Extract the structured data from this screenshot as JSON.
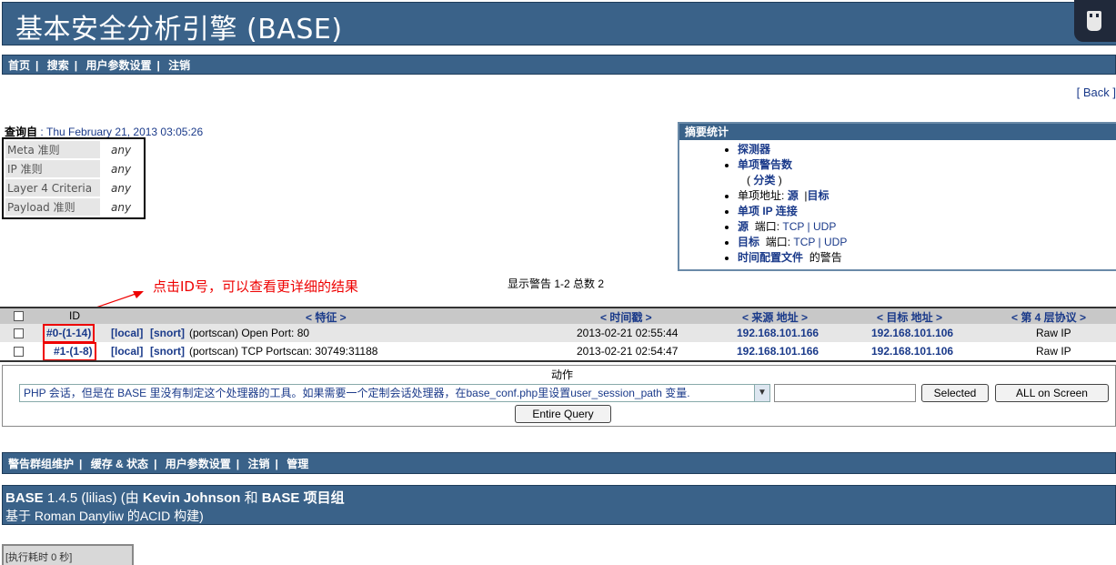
{
  "header": {
    "title": "基本安全分析引擎 (BASE)",
    "corner_icon": "usb-icon"
  },
  "topnav": {
    "items": [
      "首页",
      "搜索",
      "用户参数设置",
      "注销"
    ],
    "sep": "|"
  },
  "back_link": "[ Back ]",
  "query": {
    "label": "查询自",
    "datetime": ": Thu February 21, 2013 03:05:26",
    "criteria": [
      {
        "key": "Meta 准则",
        "value": "any"
      },
      {
        "key": "IP 准则",
        "value": "any"
      },
      {
        "key": "Layer 4 Criteria",
        "value": "any"
      },
      {
        "key": "Payload 准则",
        "value": "any"
      }
    ]
  },
  "summary": {
    "title": "摘要统计",
    "items": {
      "sensors": "探测器",
      "unique_alerts": "单项警告数",
      "categories_prefix": "(",
      "categories": "分类",
      "categories_suffix": ")",
      "unique_addr": "单项地址:",
      "src": "源",
      "sep": "|",
      "dst": "目标",
      "unique_ip_links": "单项  IP 连接",
      "src_port_label": "源",
      "port": "端口:",
      "tcp": "TCP",
      "udp": "UDP",
      "dst_port_label": "目标",
      "time_profile": "时间配置文件",
      "time_profile_suffix": "的警告"
    }
  },
  "annotation": "点击ID号，可以查看更详细的结果",
  "showing": "显示警告  1-2 总数  2",
  "table": {
    "headers": {
      "id": "ID",
      "signature": "< 特征 >",
      "timestamp": "< 时间戳 >",
      "src": "< 来源 地址 >",
      "dst": "< 目标 地址 >",
      "proto": "< 第 4 层协议 >"
    },
    "rows": [
      {
        "id": "#0-(1-14)",
        "sig_local": "[local]",
        "sig_snort": "[snort]",
        "sig_text": "(portscan) Open Port: 80",
        "time": "2013-02-21 02:55:44",
        "src": "192.168.101.166",
        "dst": "192.168.101.106",
        "proto": "Raw IP"
      },
      {
        "id": "#1-(1-8)",
        "sig_local": "[local]",
        "sig_snort": "[snort]",
        "sig_text": "(portscan) TCP Portscan: 30749:31188",
        "time": "2013-02-21 02:54:47",
        "src": "192.168.101.166",
        "dst": "192.168.101.106",
        "proto": "Raw IP"
      }
    ]
  },
  "action": {
    "label": "动作",
    "select_value": "PHP 会话，但是在  BASE 里没有制定这个处理器的工具。如果需要一个定制会话处理器，在base_conf.php里设置user_session_path 变量.",
    "btn_selected": "Selected",
    "btn_all": "ALL on Screen",
    "btn_entire": "Entire Query"
  },
  "bottomnav": {
    "items": [
      "警告群组维护",
      "缓存  & 状态",
      "用户参数设置",
      "注销",
      "管理"
    ],
    "sep": "|"
  },
  "footer": {
    "base": "BASE",
    "version": " 1.4.5 (lilias) (由 ",
    "author": "Kevin Johnson",
    "and": " 和 ",
    "group": "BASE 项目组",
    "line2": "基于  Roman Danyliw 的ACID 构建)"
  },
  "exec_time": "[执行耗时  0 秒]"
}
